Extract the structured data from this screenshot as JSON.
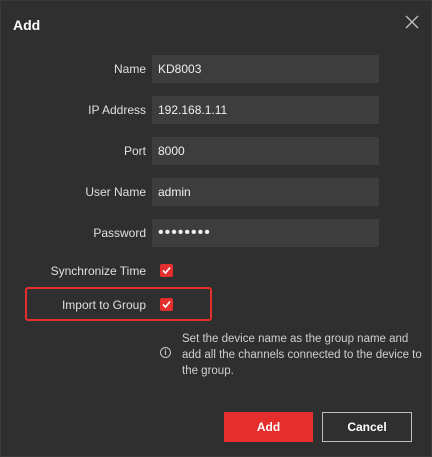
{
  "dialog": {
    "title": "Add",
    "close_icon": "close-icon"
  },
  "fields": {
    "name": {
      "label": "Name",
      "value": "KD8003"
    },
    "ip_address": {
      "label": "IP Address",
      "value": "192.168.1.11"
    },
    "port": {
      "label": "Port",
      "value": "8000"
    },
    "user_name": {
      "label": "User Name",
      "value": "admin"
    },
    "password": {
      "label": "Password",
      "value": "••••••••"
    }
  },
  "options": {
    "synchronize_time": {
      "label": "Synchronize Time",
      "checked": true
    },
    "import_to_group": {
      "label": "Import to Group",
      "checked": true
    }
  },
  "info": {
    "icon": "info-icon",
    "text": "Set the device name as the group name and add all the channels connected to the device to the group."
  },
  "buttons": {
    "add_label": "Add",
    "cancel_label": "Cancel"
  },
  "colors": {
    "accent": "#e52e2e",
    "background": "#2f2f2f",
    "input_background": "#3d3d3d"
  }
}
